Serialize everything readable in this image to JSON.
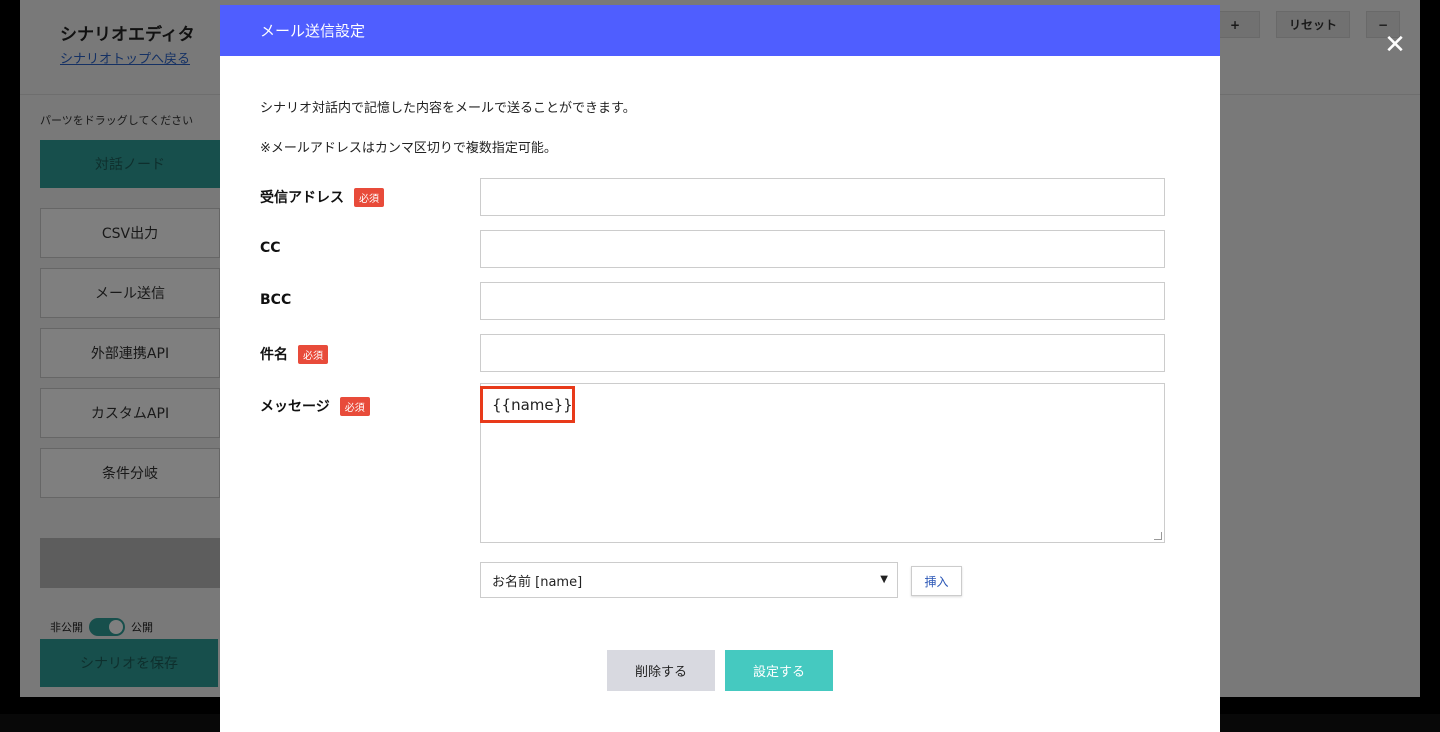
{
  "app": {
    "title": "シナリオエディタ",
    "back_link": "シナリオトップへ戻る",
    "parts_hint": "パーツをドラッグしてください",
    "parts": [
      "対話ノード",
      "CSV出力",
      "メール送信",
      "外部連携API",
      "カスタムAPI",
      "条件分岐"
    ],
    "gray_button": "",
    "toggle_private": "非公開",
    "toggle_public": "公開",
    "save_button": "シナリオを保存",
    "top_buttons": {
      "plus": "+",
      "reset": "リセット",
      "minus": "−"
    }
  },
  "modal": {
    "title": "メール送信設定",
    "description": "シナリオ対話内で記憶した内容をメールで送ることができます。",
    "note": "※メールアドレスはカンマ区切りで複数指定可能。",
    "required_label": "必須",
    "fields": {
      "to": {
        "label": "受信アドレス",
        "value": ""
      },
      "cc": {
        "label": "CC",
        "value": ""
      },
      "bcc": {
        "label": "BCC",
        "value": ""
      },
      "subject": {
        "label": "件名",
        "value": ""
      },
      "message": {
        "label": "メッセージ",
        "value": "{{name}}"
      }
    },
    "variable_select": {
      "selected": "お名前 [name]"
    },
    "insert_button": "挿入",
    "delete_button": "削除する",
    "submit_button": "設定する"
  },
  "close_icon_glyph": "✕"
}
